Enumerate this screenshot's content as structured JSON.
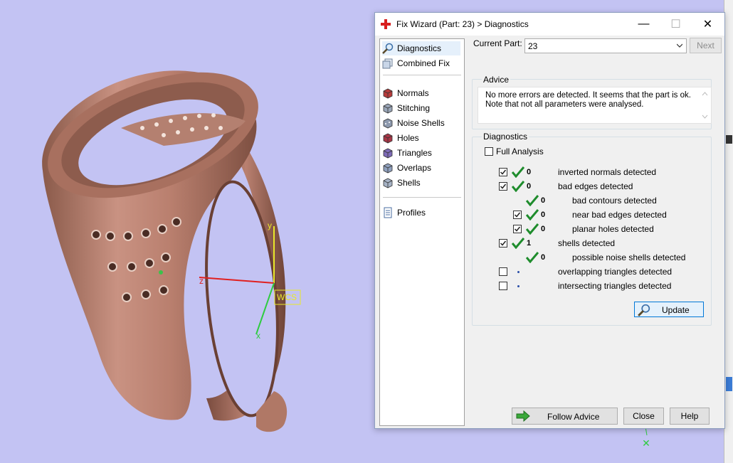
{
  "viewport": {
    "axis_labels": {
      "y": "y",
      "z": "z",
      "x": "x",
      "wcs": "WCS"
    }
  },
  "dialog": {
    "title": "Fix Wizard (Part: 23) > Diagnostics",
    "window_controls": {
      "minimize": "—",
      "maximize": "☐",
      "close": "✕"
    }
  },
  "sidebar": {
    "items": [
      {
        "label": "Diagnostics",
        "icon": "magnifier-icon"
      },
      {
        "label": "Combined Fix",
        "icon": "cubes-icon"
      },
      {
        "label": "Normals",
        "icon": "normals-cube-icon"
      },
      {
        "label": "Stitching",
        "icon": "stitching-cube-icon"
      },
      {
        "label": "Noise Shells",
        "icon": "noise-shells-icon"
      },
      {
        "label": "Holes",
        "icon": "holes-cube-icon"
      },
      {
        "label": "Triangles",
        "icon": "triangles-cube-icon"
      },
      {
        "label": "Overlaps",
        "icon": "overlaps-cube-icon"
      },
      {
        "label": "Shells",
        "icon": "shells-cube-icon"
      },
      {
        "label": "Profiles",
        "icon": "document-icon"
      }
    ]
  },
  "current_part": {
    "label": "Current Part:",
    "value": "23",
    "next_label": "Next"
  },
  "advice": {
    "title": "Advice",
    "text_line1": "No more errors are detected. It seems that the part is ok.",
    "text_line2": "Note that not all parameters were analysed."
  },
  "diagnostics": {
    "title": "Diagnostics",
    "full_analysis_label": "Full Analysis",
    "full_analysis_checked": false,
    "rows": [
      {
        "label": "inverted normals detected",
        "count": "0",
        "checked": true
      },
      {
        "label": "bad edges detected",
        "count": "0",
        "checked": true
      },
      {
        "label": "bad contours detected",
        "count": "0"
      },
      {
        "label": "near bad edges detected",
        "count": "0",
        "checked": true
      },
      {
        "label": "planar holes detected",
        "count": "0",
        "checked": true
      },
      {
        "label": "shells detected",
        "count": "1",
        "checked": true
      },
      {
        "label": "possible noise shells detected",
        "count": "0"
      },
      {
        "label": "overlapping triangles detected",
        "checked": false
      },
      {
        "label": "intersecting triangles detected",
        "checked": false
      }
    ],
    "update_label": "Update"
  },
  "footer": {
    "follow_advice_label": "Follow Advice",
    "close_label": "Close",
    "help_label": "Help"
  },
  "colors": {
    "accent": "#0078d7",
    "check_green": "#1e8c2c",
    "ring": "#c08a7a",
    "background": "#c3c3f3"
  }
}
